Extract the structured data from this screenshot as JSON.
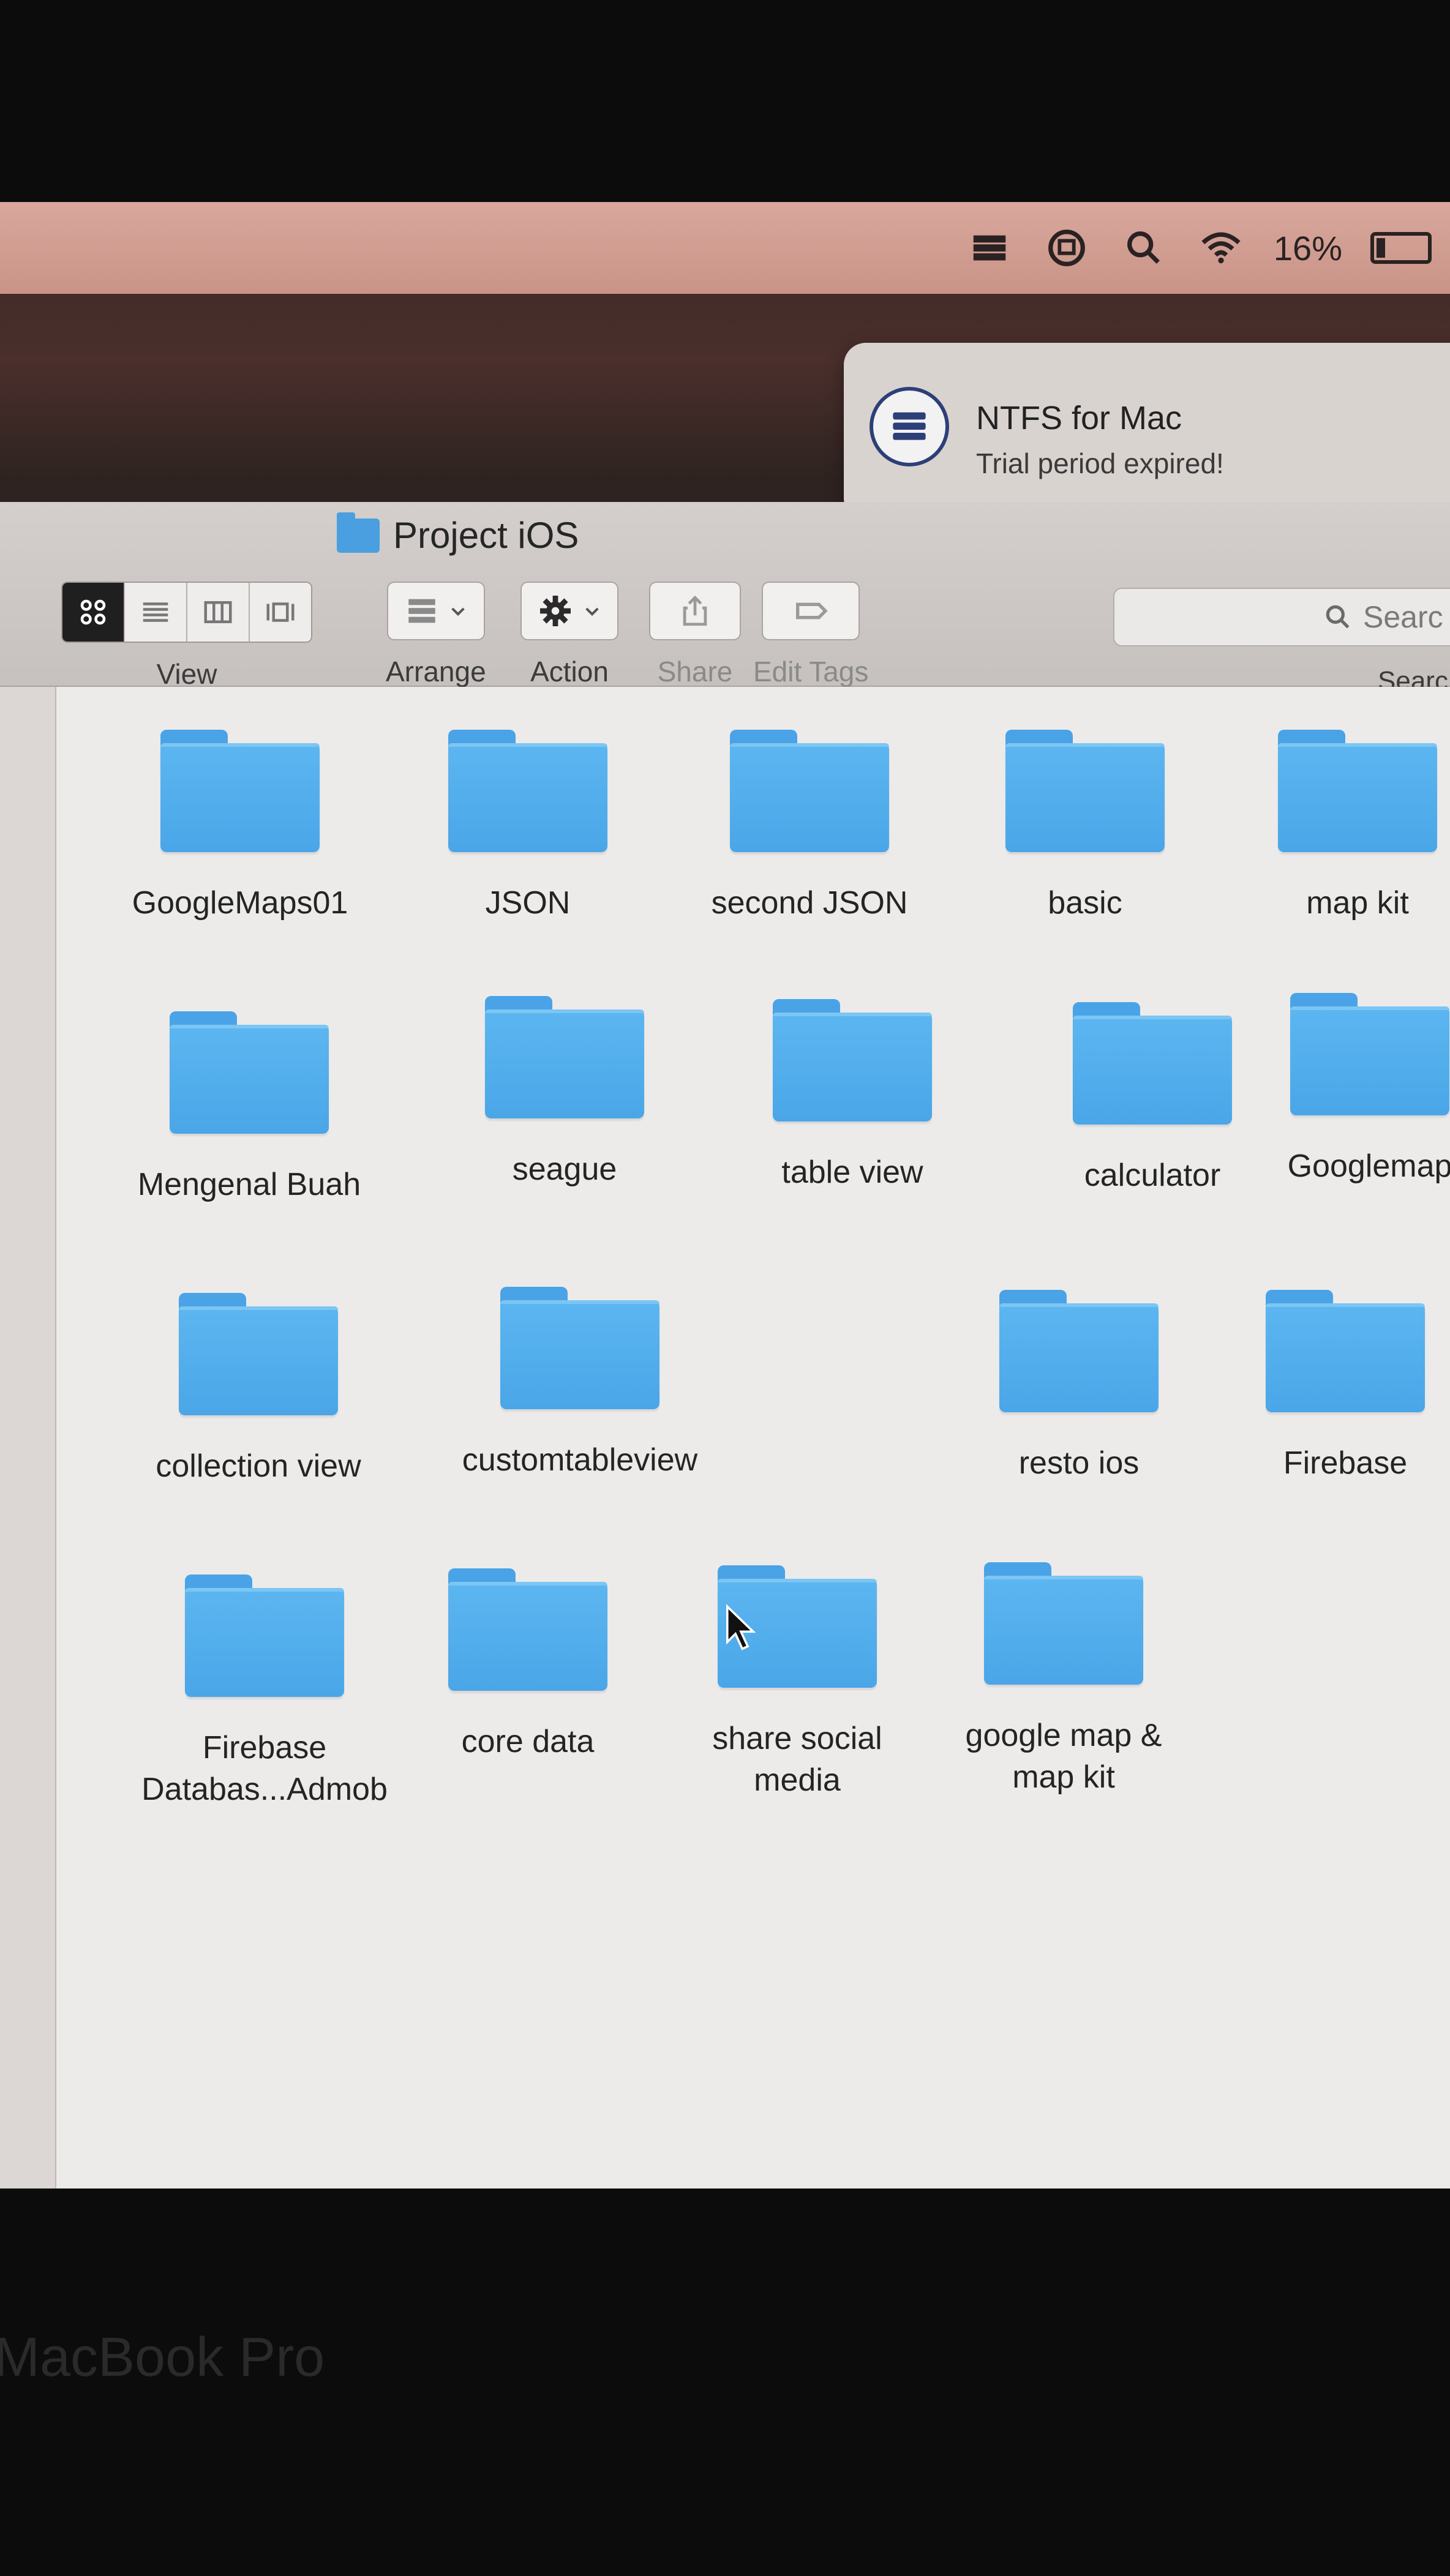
{
  "menubar": {
    "battery_percent": "16%",
    "icons": [
      "ntfs-drive-icon",
      "screen-sharing-icon",
      "spotlight-search-icon",
      "wifi-icon",
      "battery-icon"
    ]
  },
  "notification": {
    "title": "NTFS for Mac",
    "message": "Trial period expired!"
  },
  "window": {
    "title": "Project iOS",
    "toolbar": {
      "view_label": "View",
      "arrange_label": "Arrange",
      "action_label": "Action",
      "share_label": "Share",
      "edit_tags_label": "Edit Tags",
      "search_placeholder": "Searc",
      "search_label": "Searc"
    }
  },
  "items": [
    "GoogleMaps01",
    "JSON",
    "second JSON",
    "basic",
    "map kit",
    "Mengenal Buah",
    "seague",
    "table view",
    "calculator",
    "Googlemap",
    "collection view",
    "customtableview",
    "resto ios",
    "Firebase",
    "Firebase Databas...Admob",
    "core data",
    "share social media",
    "google map & map kit"
  ],
  "bezel": {
    "brand": "MacBook Pro"
  },
  "colors": {
    "folder_blue": "#4aa6e8",
    "menubar": "#d9a79c"
  }
}
